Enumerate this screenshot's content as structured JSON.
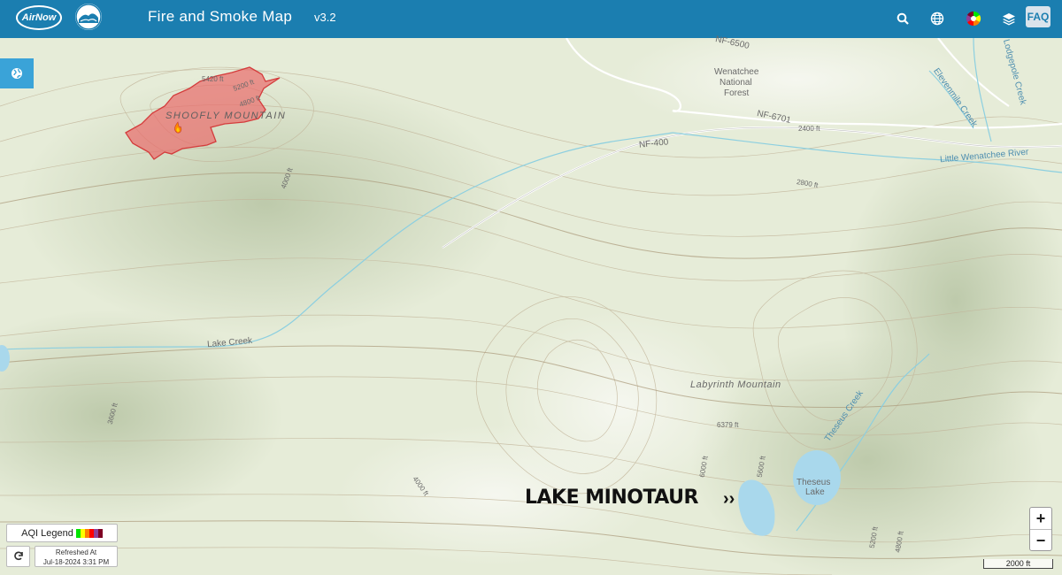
{
  "header": {
    "logo_text": "AirNow",
    "title": "Fire and Smoke Map",
    "version": "v3.2",
    "faq_label": "FAQ",
    "icons": [
      "search-icon",
      "globe-icon",
      "aqi-color-wheel-icon",
      "layers-icon"
    ]
  },
  "map": {
    "labels": {
      "nf6500": "NF-6500",
      "wenatchee": "Wenatchee",
      "national": "National",
      "forest": "Forest",
      "nf6701": "NF-6701",
      "nf400": "NF-400",
      "ft2400": "2400 ft",
      "ft2800": "2800 ft",
      "ft4000a": "4000 ft",
      "ft4000b": "4000 ft",
      "ft3600": "3600 ft",
      "ft5420": "5420 ft",
      "ft5200": "5200 ft",
      "ft4800": "4800 ft",
      "ft6379": "6379 ft",
      "ft6000": "6000 ft",
      "ft5600": "5600 ft",
      "ft5200b": "5200 ft",
      "ft4800b": "4800 ft",
      "shoofly": "SHOOFLY MOUNTAIN",
      "lake_creek": "Lake Creek",
      "labyrinth": "Labyrinth Mountain",
      "theseus_creek": "Theseus Creek",
      "theseus_lake_1": "Theseus",
      "theseus_lake_2": "Lake",
      "eleven_mile": "Elevenmile Creek",
      "lodgepole": "Lodgepole Creek",
      "little_wenatchee": "Little Wenatchee River"
    },
    "callout": "LAKE MINOTAUR",
    "callout_arrow": "››",
    "scale": "2000 ft",
    "zoom_in": "+",
    "zoom_out": "−",
    "fire_perimeter_color": "#e96b6b"
  },
  "footer": {
    "aqi_legend_label": "AQI Legend",
    "aqi_colors": [
      "#00e400",
      "#ffff00",
      "#ff7e00",
      "#ff0000",
      "#8f3f97",
      "#7e0023"
    ],
    "refreshed_label": "Refreshed At",
    "refreshed_time": "Jul-18-2024 3:31 PM"
  }
}
